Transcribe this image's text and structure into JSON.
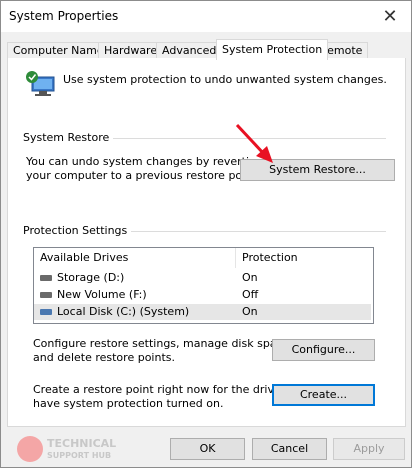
{
  "window": {
    "title": "System Properties",
    "close_glyph": "✕"
  },
  "tabs": [
    {
      "label": "Computer Name",
      "active": false
    },
    {
      "label": "Hardware",
      "active": false
    },
    {
      "label": "Advanced",
      "active": false
    },
    {
      "label": "System Protection",
      "active": true
    },
    {
      "label": "Remote",
      "active": false
    }
  ],
  "intro": "Use system protection to undo unwanted system changes.",
  "restore": {
    "group_title": "System Restore",
    "description_line1": "You can undo system changes by reverting",
    "description_line2": "your computer to a previous restore point.",
    "button_label": "System Restore..."
  },
  "protection": {
    "group_title": "Protection Settings",
    "columns": [
      "Available Drives",
      "Protection"
    ],
    "drives": [
      {
        "name": "Storage (D:)",
        "protection": "On",
        "icon": "drive-icon",
        "selected": false
      },
      {
        "name": "New Volume (F:)",
        "protection": "Off",
        "icon": "drive-icon",
        "selected": false
      },
      {
        "name": "Local Disk (C:) (System)",
        "protection": "On",
        "icon": "system-drive-icon",
        "selected": true
      }
    ],
    "configure_line1": "Configure restore settings, manage disk space,",
    "configure_line2": "and delete restore points.",
    "configure_button": "Configure...",
    "create_line1": "Create a restore point right now for the drives that",
    "create_line2": "have system protection turned on.",
    "create_button": "Create..."
  },
  "footer": {
    "ok": "OK",
    "cancel": "Cancel",
    "apply": "Apply"
  },
  "watermark": {
    "line1": "TECHNICAL",
    "line2": "SUPPORT HUB"
  },
  "colors": {
    "accent": "#0078d7",
    "arrow": "#e81123"
  }
}
